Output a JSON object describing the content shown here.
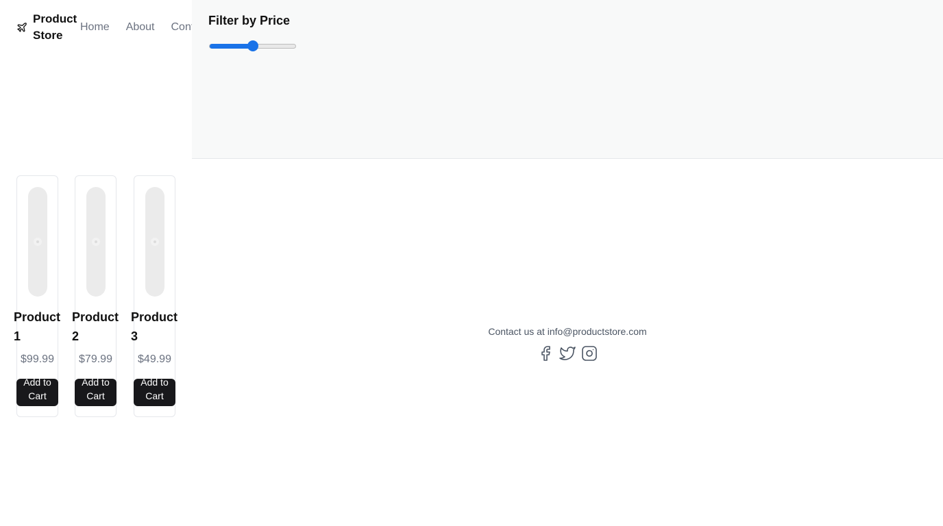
{
  "brand": {
    "name": "Product Store",
    "icon": "plane-icon"
  },
  "nav": {
    "items": [
      {
        "label": "Home"
      },
      {
        "label": "About"
      },
      {
        "label": "Contact"
      }
    ]
  },
  "filter": {
    "title": "Filter by Price",
    "slider_value_fraction": 0.5,
    "accent_color": "#1a73e8"
  },
  "products": [
    {
      "name": "Product 1",
      "price": "$99.99",
      "button_label": "Add to Cart",
      "image_icon": "image-placeholder-icon"
    },
    {
      "name": "Product 2",
      "price": "$79.99",
      "button_label": "Add to Cart",
      "image_icon": "image-placeholder-icon"
    },
    {
      "name": "Product 3",
      "price": "$49.99",
      "button_label": "Add to Cart",
      "image_icon": "image-placeholder-icon"
    }
  ],
  "footer": {
    "text": "Contact us at info@productstore.com",
    "socials": [
      {
        "icon": "facebook-icon"
      },
      {
        "icon": "twitter-icon"
      },
      {
        "icon": "instagram-icon"
      }
    ]
  }
}
